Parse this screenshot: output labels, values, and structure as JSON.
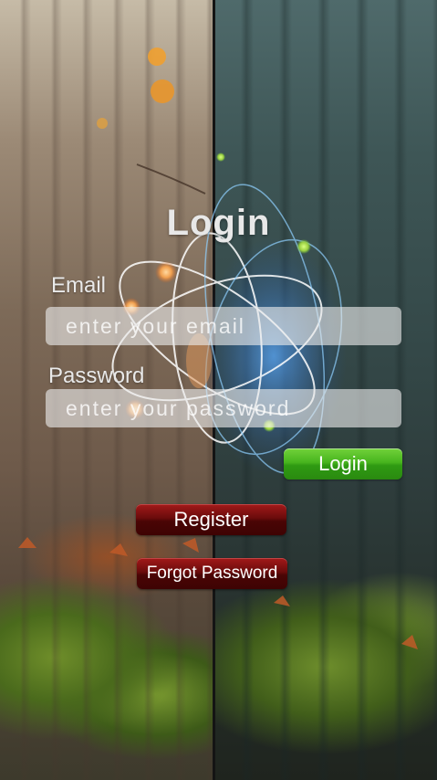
{
  "login_form": {
    "title": "Login",
    "email_label": "Email",
    "email_placeholder": "enter your email",
    "email_value": "",
    "password_label": "Password",
    "password_placeholder": "enter your password",
    "password_value": "",
    "login_button": "Login",
    "register_button": "Register",
    "forgot_password_button": "Forgot Password"
  },
  "colors": {
    "login_button": "#47b41e",
    "secondary_buttons": "#6a0b0b",
    "field_background": "rgba(235,235,235,0.62)",
    "text": "#e8e8e8"
  },
  "background": {
    "description_icon": "split-forest-atom-background"
  }
}
